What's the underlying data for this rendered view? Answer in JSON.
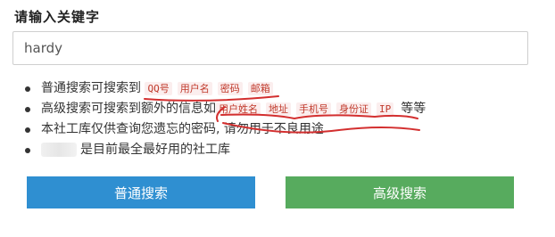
{
  "title": "请输入关键字",
  "search": {
    "value": "hardy"
  },
  "tips": [
    {
      "text": "普通搜索可搜索到",
      "tags": [
        "QQ号",
        "用户名",
        "密码",
        "邮箱"
      ],
      "after": ""
    },
    {
      "text": "高级搜索可搜索到额外的信息如",
      "tags": [
        "用户姓名",
        "地址",
        "手机号",
        "身份证",
        "IP"
      ],
      "after": "等等"
    },
    {
      "text": "本社工库仅供查询您遗忘的密码, 请勿用于不良用途",
      "tags": [],
      "after": ""
    },
    {
      "text": "是目前最全最好用的社工库",
      "tags": [],
      "after": ""
    }
  ],
  "buttons": {
    "basic": "普通搜索",
    "advanced": "高级搜索"
  },
  "colors": {
    "basic": "#2f8fd1",
    "advanced": "#57ab5e",
    "tag": "#c0392b",
    "annotation": "#d32f2f"
  }
}
